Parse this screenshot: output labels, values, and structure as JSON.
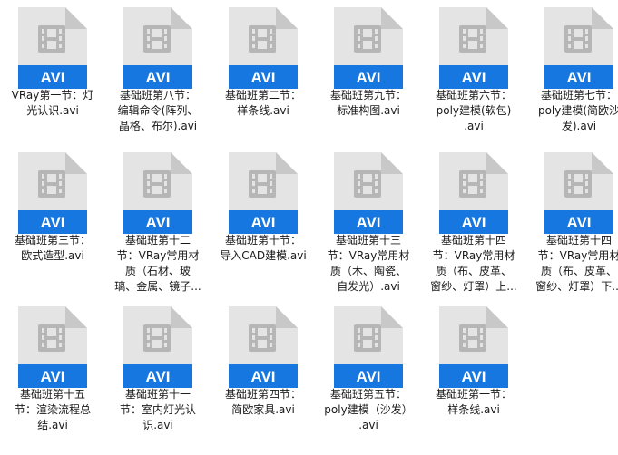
{
  "badge_text": "AVI",
  "colors": {
    "badge_blue": "#1677e0",
    "page_gray": "#e4e4e4",
    "fold_gray": "#c8c8c8",
    "film_gray": "#b6b6b6"
  },
  "files": [
    {
      "lines": [
        "VRay第一节：灯",
        "光认识.avi"
      ]
    },
    {
      "lines": [
        "基础班第八节：",
        "编辑命令(阵列、",
        "晶格、布尔).avi"
      ]
    },
    {
      "lines": [
        "基础班第二节：",
        "样条线.avi"
      ]
    },
    {
      "lines": [
        "基础班第九节：",
        "标准构图.avi"
      ]
    },
    {
      "lines": [
        "基础班第六节：",
        "poly建模(软包)",
        ".avi"
      ]
    },
    {
      "lines": [
        "基础班第七节：",
        "poly建模(简欧沙",
        "发).avi"
      ]
    },
    {
      "lines": [
        "基础班第三节：",
        "欧式造型.avi"
      ]
    },
    {
      "lines": [
        "基础班第十二",
        "节：VRay常用材",
        "质（石材、玻",
        "璃、金属、镜子..."
      ]
    },
    {
      "lines": [
        "基础班第十节：",
        "导入CAD建模.avi"
      ]
    },
    {
      "lines": [
        "基础班第十三",
        "节：VRay常用材",
        "质（木、陶瓷、",
        "自发光）.avi"
      ]
    },
    {
      "lines": [
        "基础班第十四",
        "节：VRay常用材",
        "质（布、皮革、",
        "窗纱、灯罩）上..."
      ]
    },
    {
      "lines": [
        "基础班第十四",
        "节：VRay常用材",
        "质（布、皮革、",
        "窗纱、灯罩）下..."
      ]
    },
    {
      "lines": [
        "基础班第十五",
        "节：渲染流程总",
        "结.avi"
      ]
    },
    {
      "lines": [
        "基础班第十一",
        "节：室内灯光认",
        "识.avi"
      ]
    },
    {
      "lines": [
        "基础班第四节：",
        "简欧家具.avi"
      ]
    },
    {
      "lines": [
        "基础班第五节：",
        "poly建模（沙发）",
        ".avi"
      ]
    },
    {
      "lines": [
        "基础班第一节：",
        "样条线.avi"
      ]
    }
  ]
}
